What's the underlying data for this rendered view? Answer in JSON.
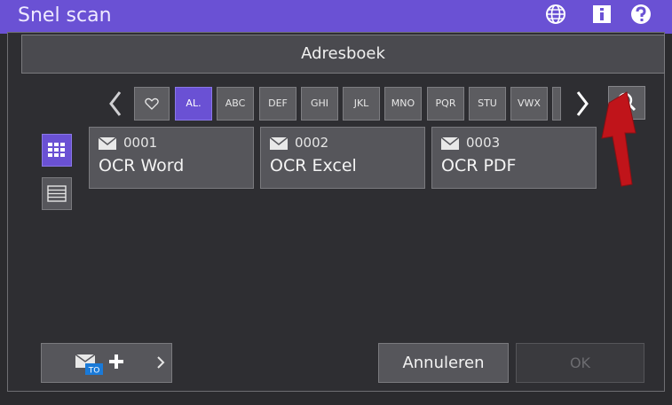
{
  "app": {
    "title": "Snel scan"
  },
  "dialog": {
    "title": "Adresboek"
  },
  "tabs": [
    {
      "label": ""
    },
    {
      "label": "AL."
    },
    {
      "label": "ABC"
    },
    {
      "label": "DEF"
    },
    {
      "label": "GHI"
    },
    {
      "label": "JKL"
    },
    {
      "label": "MNO"
    },
    {
      "label": "PQR"
    },
    {
      "label": "STU"
    },
    {
      "label": "VWX"
    }
  ],
  "active_tab": "AL.",
  "entries": [
    {
      "number": "0001",
      "name": "OCR Word"
    },
    {
      "number": "0002",
      "name": "OCR Excel"
    },
    {
      "number": "0003",
      "name": "OCR PDF"
    }
  ],
  "buttons": {
    "add_badge": "TO",
    "cancel": "Annuleren",
    "ok": "OK"
  },
  "colors": {
    "accent": "#6a51d4",
    "annotation_arrow": "#c0141a"
  }
}
